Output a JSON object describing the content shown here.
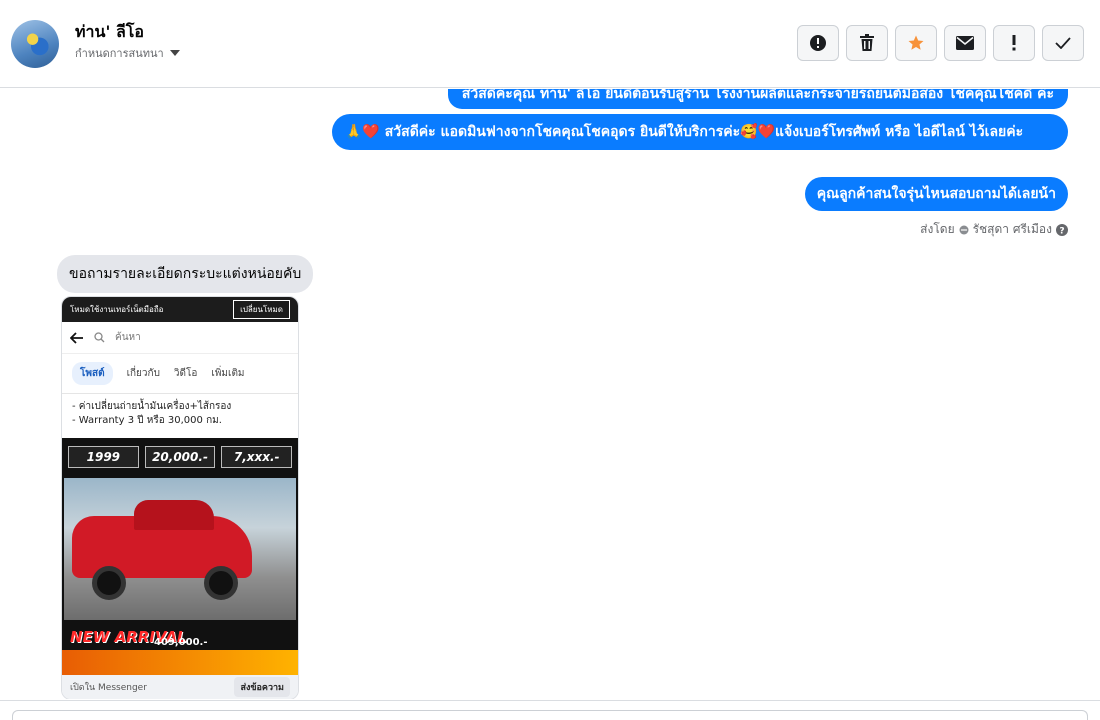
{
  "header": {
    "contact_name": "ท่าน' ลีโอ",
    "assign_label": "กำหนดการสนทนา",
    "actions": [
      {
        "icon": "alert-circle-icon",
        "name": "report-button"
      },
      {
        "icon": "trash-icon",
        "name": "delete-button"
      },
      {
        "icon": "star-icon",
        "name": "star-button",
        "color": "#f7923a"
      },
      {
        "icon": "envelope-icon",
        "name": "mark-unread-button"
      },
      {
        "icon": "exclamation-icon",
        "name": "spam-button"
      },
      {
        "icon": "check-icon",
        "name": "done-button"
      }
    ]
  },
  "messages": {
    "out1": "สวัสดีค่ะคุณ ท่าน' ลีโอ ยินดีต้อนรับสู่ร้าน โรงงานผลิตและกระจายรถยนต์มือสอง โชคคุณโชคดี ค่ะ",
    "out2": "🙏❤️ สวัสดีค่ะ แอดมินฟางจากโชคคุณโชคอุดร ยินดีให้บริการค่ะ🥰❤️แจ้งเบอร์โทรศัพท์ หรือ ไอดีไลน์  ไว้เลยค่ะ",
    "out3": "คุณลูกค้าสนใจรุ่นไหนสอบถามได้เลยน้า",
    "sent_by_label": "ส่งโดย",
    "sent_by_name": "รัชสุดา ศรีเมือง",
    "in1": "ขอถามรายละเอียดกระบะแต่งหน่อยคับ"
  },
  "attachment": {
    "top_text": "โหมดใช้งานเทอร์เน็ตมือถือ",
    "switch_label": "เปลี่ยนโหมด",
    "search_placeholder": "ค้นหา",
    "tabs": [
      "โพสต์",
      "เกี่ยวกับ",
      "วิดีโอ",
      "เพิ่มเติม"
    ],
    "text_line1": "- ค่าเปลี่ยนถ่ายน้ำมันเครื่อง+ไส้กรอง",
    "text_line2": "- Warranty 3 ปี หรือ 30,000 กม.",
    "price_a": "1999",
    "price_b": "20,000.-",
    "price_c": "7,xxx.-",
    "new_arrival": "NEW ARRIVAL",
    "ad_price": "409,000.-",
    "open_in": "เปิดใน Messenger",
    "send_label": "ส่งข้อความ"
  }
}
